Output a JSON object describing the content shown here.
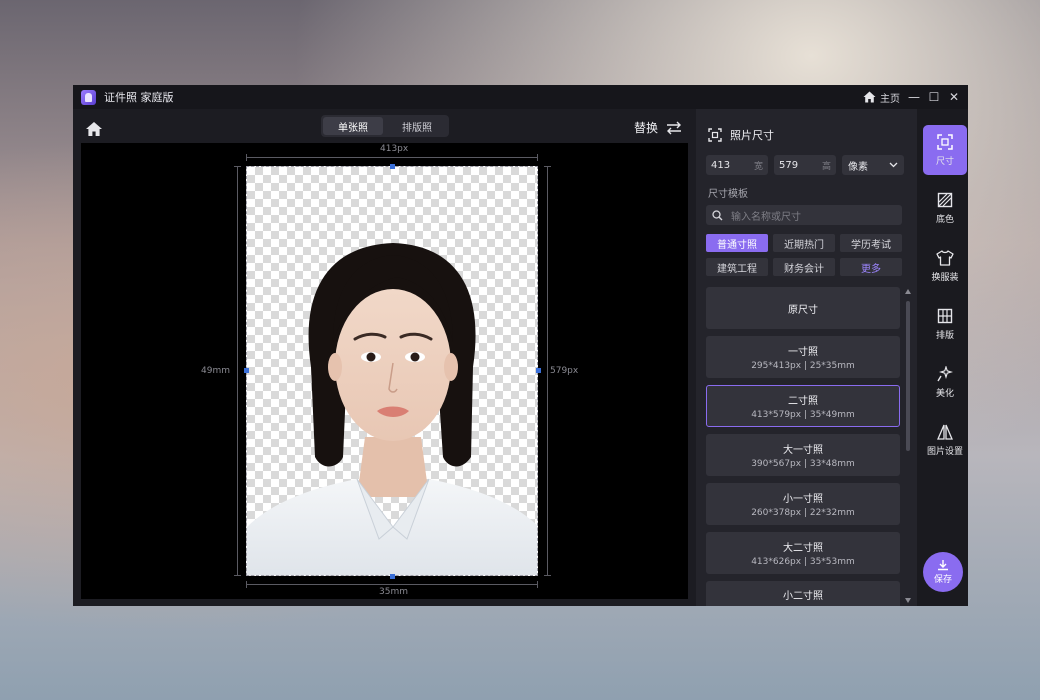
{
  "titlebar": {
    "app_title": "证件照 家庭版",
    "home_label": "主页",
    "minimize": "—",
    "maximize": "☐",
    "close": "✕"
  },
  "canvas_toolbar": {
    "tabs": [
      {
        "label": "单张照",
        "active": true
      },
      {
        "label": "排版照",
        "active": false
      }
    ],
    "replace_label": "替换"
  },
  "canvas": {
    "width_px_label": "413px",
    "height_px_label": "579px",
    "width_mm_label": "35mm",
    "height_mm_label": "49mm"
  },
  "panel": {
    "title": "照片尺寸",
    "width_value": "413",
    "width_unit": "宽",
    "height_value": "579",
    "height_unit": "高",
    "unit_select": "像素",
    "template_label": "尺寸模板",
    "search_placeholder": "输入名称或尺寸",
    "chips": [
      {
        "label": "普通寸照",
        "active": true
      },
      {
        "label": "近期热门",
        "active": false
      },
      {
        "label": "学历考试",
        "active": false
      },
      {
        "label": "建筑工程",
        "active": false
      },
      {
        "label": "财务会计",
        "active": false
      },
      {
        "label": "更多",
        "active": false
      }
    ],
    "presets": [
      {
        "name": "原尺寸",
        "dims": ""
      },
      {
        "name": "一寸照",
        "dims": "295*413px | 25*35mm"
      },
      {
        "name": "二寸照",
        "dims": "413*579px | 35*49mm",
        "selected": true
      },
      {
        "name": "大一寸照",
        "dims": "390*567px | 33*48mm"
      },
      {
        "name": "小一寸照",
        "dims": "260*378px | 22*32mm"
      },
      {
        "name": "大二寸照",
        "dims": "413*626px | 35*53mm"
      },
      {
        "name": "小二寸照",
        "dims": ""
      }
    ]
  },
  "rail": {
    "items": [
      {
        "label": "尺寸",
        "icon": "size-icon",
        "active": true
      },
      {
        "label": "底色",
        "icon": "background-color-icon"
      },
      {
        "label": "换服装",
        "icon": "clothing-icon"
      },
      {
        "label": "排版",
        "icon": "layout-icon"
      },
      {
        "label": "美化",
        "icon": "beautify-icon"
      },
      {
        "label": "图片设置",
        "icon": "image-settings-icon"
      }
    ],
    "save_label": "保存"
  },
  "colors": {
    "accent": "#8a6cf0",
    "window_bg": "#1c1c22",
    "panel_bg": "#24242b",
    "canvas_bg": "#000000"
  }
}
